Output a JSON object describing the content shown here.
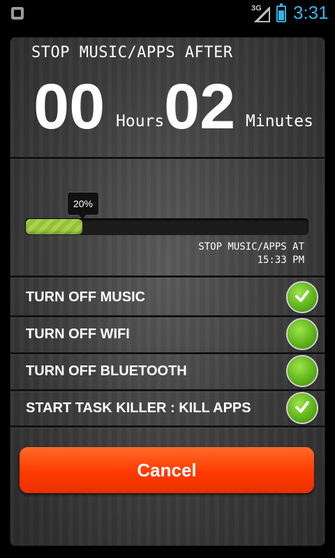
{
  "status_bar": {
    "network_label": "3G",
    "time": "3:31",
    "accent_color": "#33b5e5",
    "battery_level_fraction": 0.7
  },
  "header": {
    "title": "STOP MUSIC/APPS AFTER",
    "hours_value": "00",
    "hours_unit": "Hours",
    "minutes_value": "02",
    "minutes_unit": "Minutes"
  },
  "progress": {
    "percent_label": "20%",
    "value_fraction": 0.2,
    "stop_at_label": "STOP MUSIC/APPS AT",
    "stop_at_time": "15:33 PM",
    "fill_color": "#a9d34e"
  },
  "options": [
    {
      "label": "TURN OFF MUSIC",
      "checked": true
    },
    {
      "label": "TURN OFF WIFI",
      "checked": false
    },
    {
      "label": "TURN OFF BLUETOOTH",
      "checked": false
    },
    {
      "label": "START TASK KILLER : KILL APPS",
      "checked": true
    }
  ],
  "cancel_button": {
    "label": "Cancel",
    "color": "#ff4a0a"
  }
}
